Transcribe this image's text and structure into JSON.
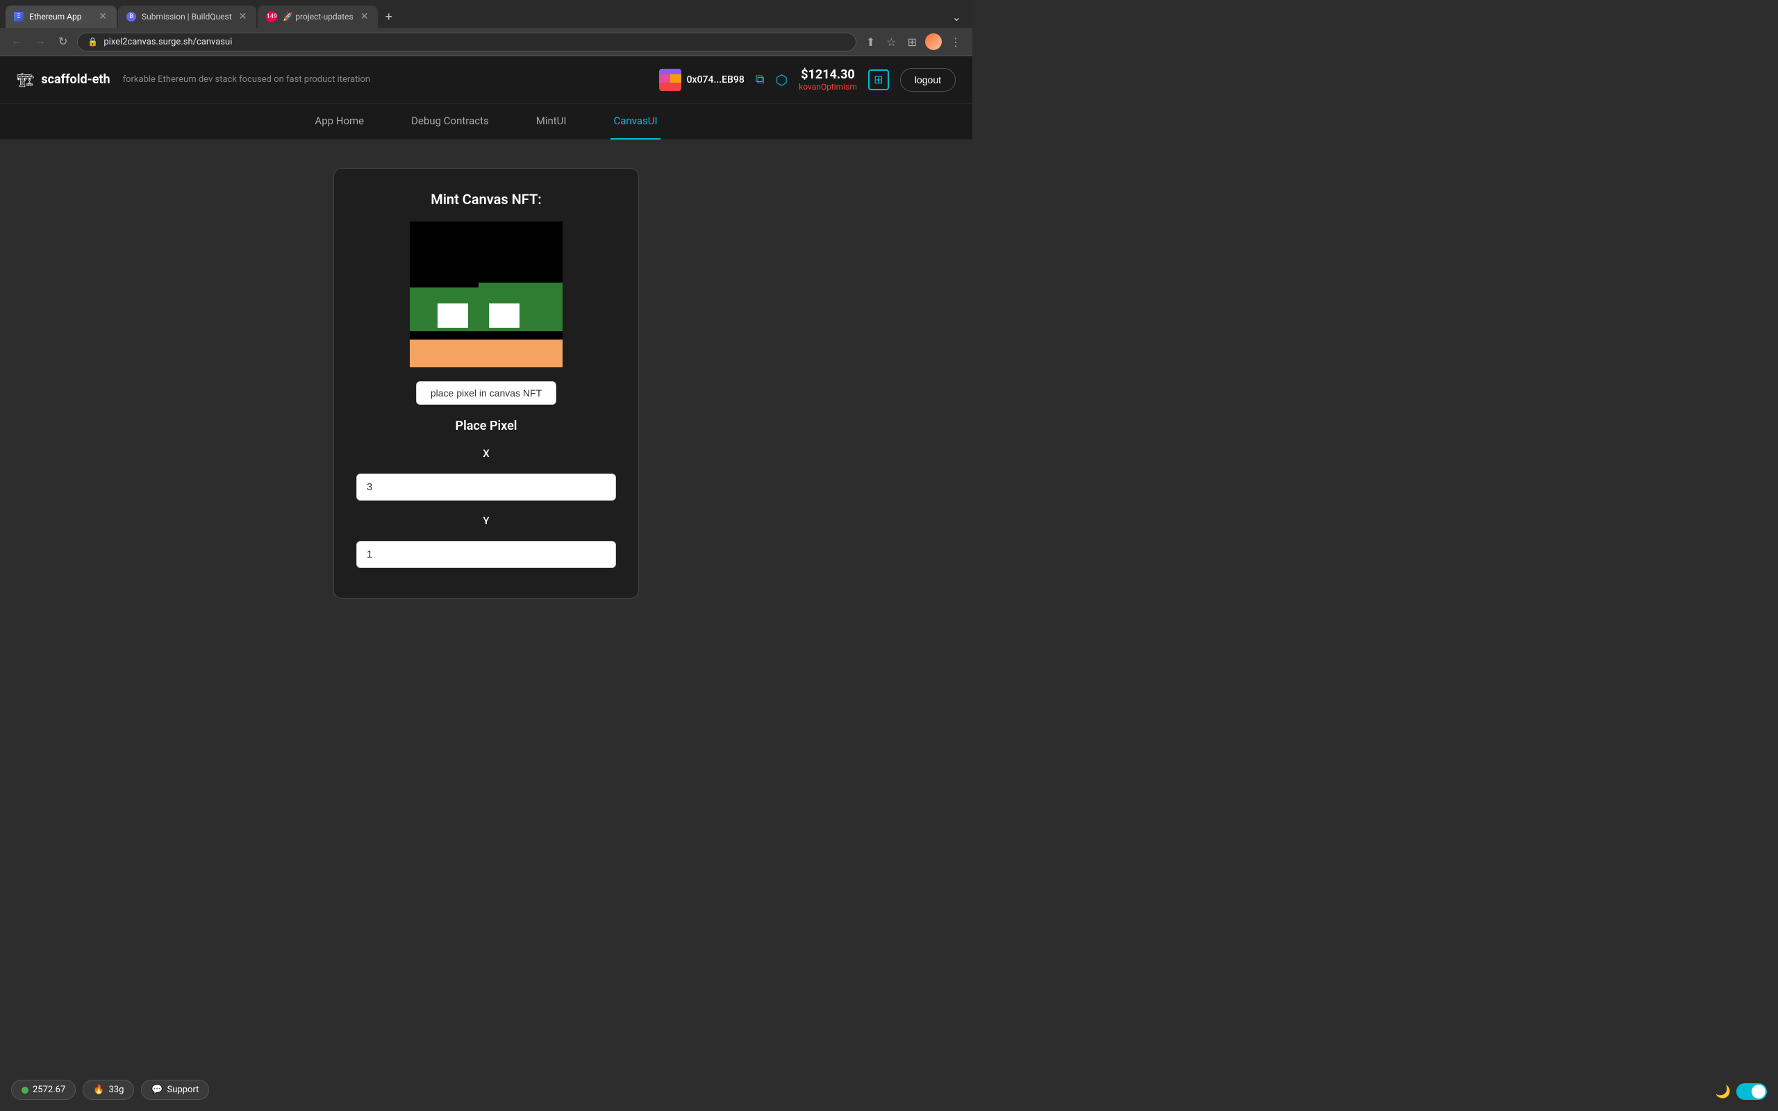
{
  "browser": {
    "tabs": [
      {
        "id": "tab1",
        "favicon": "eth",
        "title": "Ethereum App",
        "active": true
      },
      {
        "id": "tab2",
        "favicon": "bq",
        "title": "Submission | BuildQuest",
        "active": false
      },
      {
        "id": "tab3",
        "favicon": "rocket",
        "title": "🚀 project-updates",
        "active": false,
        "badge": "149"
      }
    ],
    "url": "pixel2canvas.surge.sh/canvasui",
    "new_tab_label": "+",
    "overflow_label": "⌄"
  },
  "header": {
    "brand_icon": "🏗",
    "brand_name": "scaffold-eth",
    "brand_desc": "forkable Ethereum dev stack focused on fast product iteration",
    "wallet_address": "0x074...EB98",
    "balance": "$1214.30",
    "network": "kovanOptimism",
    "logout_label": "logout"
  },
  "nav": {
    "items": [
      {
        "id": "app-home",
        "label": "App Home",
        "active": false
      },
      {
        "id": "debug-contracts",
        "label": "Debug Contracts",
        "active": false
      },
      {
        "id": "mint-ui",
        "label": "MintUI",
        "active": false
      },
      {
        "id": "canvas-ui",
        "label": "CanvasUI",
        "active": true
      }
    ]
  },
  "main": {
    "card_title": "Mint Canvas NFT:",
    "place_pixel_btn": "place pixel in canvas NFT",
    "place_pixel_title": "Place Pixel",
    "x_label": "X",
    "x_value": "3",
    "x_placeholder": "3",
    "y_label": "Y",
    "y_value": "1",
    "y_placeholder": "1"
  },
  "bottom": {
    "balance": "2572.67",
    "gas": "33g",
    "support_label": "Support"
  },
  "icons": {
    "back": "←",
    "forward": "→",
    "refresh": "↻",
    "lock": "🔒",
    "star": "☆",
    "extensions": "⊞",
    "menu": "⋮",
    "share": "⬆",
    "copy": "⧉",
    "network_icon": "⬡",
    "moon": "🌙",
    "chat": "💬",
    "fire": "🔥"
  }
}
